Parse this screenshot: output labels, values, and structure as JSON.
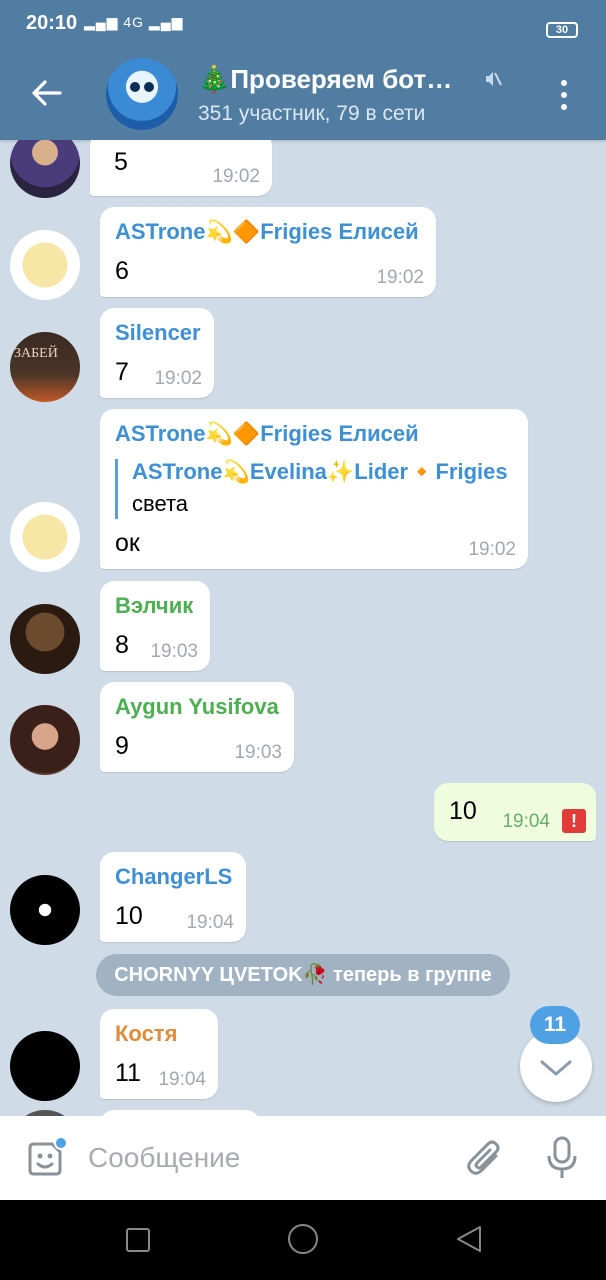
{
  "status_bar": {
    "time": "20:10",
    "signal": "4G",
    "battery": "30"
  },
  "header": {
    "title": "🎄Проверяем бот…",
    "subtitle": "351 участник, 79 в сети"
  },
  "messages": [
    {
      "sender": "",
      "text": "5",
      "time": "19:02"
    },
    {
      "sender": "ASTrone💫🔶Frigies Елисей",
      "sender_color": "#3d8fd6",
      "text": "6",
      "time": "19:02"
    },
    {
      "sender": "Silencer",
      "sender_color": "#3d8fd6",
      "text": "7",
      "time": "19:02",
      "avatar_text": "ЗАБЕЙ"
    },
    {
      "sender": "ASTrone💫🔶Frigies Елисей",
      "sender_color": "#3d8fd6",
      "reply_name": "ASTrone💫Evelina✨Lider🔸Frigies",
      "reply_text": "света",
      "text": "ок",
      "time": "19:02"
    },
    {
      "sender": "Вэлчик",
      "sender_color": "#4caf50",
      "text": "8",
      "time": "19:03"
    },
    {
      "sender": "Aygun Yusifova",
      "sender_color": "#4caf50",
      "text": "9",
      "time": "19:03"
    },
    {
      "sender": "",
      "text": "10",
      "time": "19:04",
      "outgoing": true
    },
    {
      "sender": "ChangerLS",
      "sender_color": "#3d8fd6",
      "text": "10",
      "time": "19:04"
    },
    {
      "sender": "Костя",
      "sender_color": "#e08c3c",
      "text": "11",
      "time": "19:04"
    }
  ],
  "service_message": "CHORNYY ЦVETOK🥀 теперь в группе",
  "unread_count": "11",
  "input": {
    "placeholder": "Сообщение"
  },
  "icons": [
    "back-arrow-icon",
    "mute-icon",
    "more-vertical-icon",
    "emoji-sticker-icon",
    "paperclip-icon",
    "microphone-icon",
    "chevron-down-icon",
    "error-icon"
  ],
  "colors": {
    "header": "#527da3",
    "accent": "#4fa1e3",
    "outgoing_bubble": "#effdde",
    "error": "#e33a3a"
  }
}
